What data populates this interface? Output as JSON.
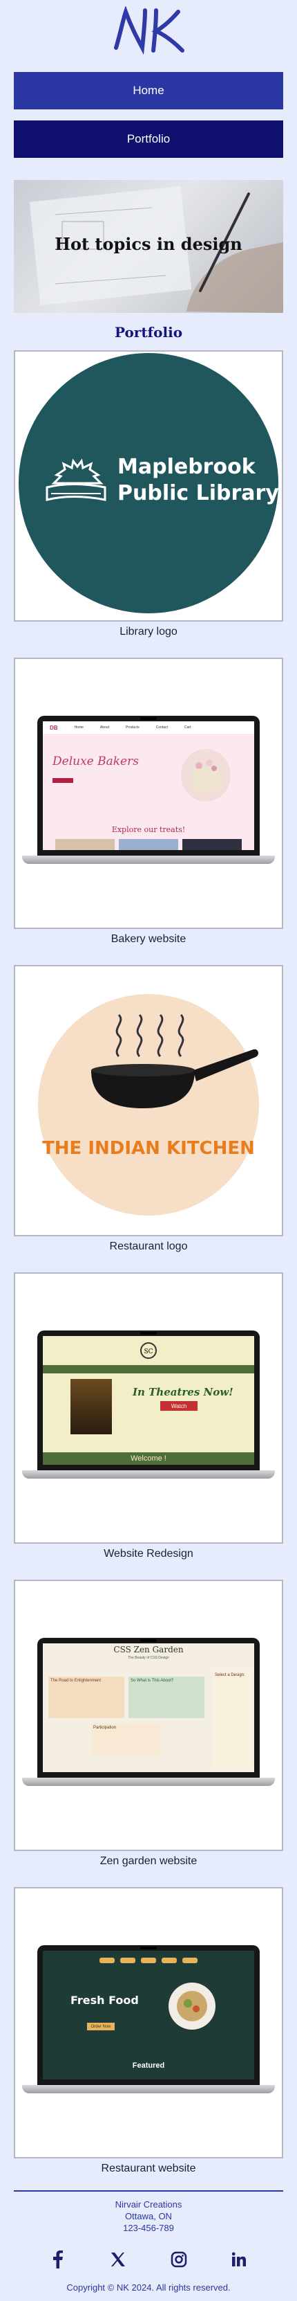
{
  "header": {
    "logo_text": "NK"
  },
  "nav": {
    "home_label": "Home",
    "portfolio_label": "Portfolio"
  },
  "hero": {
    "title": "Hot topics in design"
  },
  "portfolio": {
    "title": "Portfolio",
    "items": [
      {
        "caption": "Library logo",
        "line1": "Maplebrook",
        "line2": "Public Library"
      },
      {
        "caption": "Bakery website",
        "site_title": "Deluxe Bakers",
        "tagline": "Explore our treats!",
        "nav": [
          "Home",
          "About",
          "Products",
          "Contact",
          "Cart"
        ]
      },
      {
        "caption": "Restaurant logo",
        "brand": "THE INDIAN KITCHEN"
      },
      {
        "caption": "Website Redesign",
        "headline": "In Theatres Now!",
        "cta": "Watch",
        "welcome": "Welcome !"
      },
      {
        "caption": "Zen garden website",
        "site_title": "CSS Zen Garden",
        "subtitle": "The Beauty of CSS Design",
        "col_a": "The Road to Enlightenment",
        "col_b": "So What is This About?",
        "col_c": "Participation",
        "side": "Select a Design:"
      },
      {
        "caption": "Restaurant website",
        "headline": "Fresh Food",
        "cta": "Order Now",
        "featured": "Featured"
      }
    ]
  },
  "footer": {
    "name": "Nirvair Creations",
    "location": "Ottawa, ON",
    "phone": "123-456-789",
    "copyright": "Copyright © NK 2024. All rights reserved.",
    "socials": [
      "facebook-icon",
      "x-icon",
      "instagram-icon",
      "linkedin-icon"
    ]
  },
  "colors": {
    "primary": "#2a36a2",
    "navy": "#0f0f6e",
    "background": "#e6ecfb",
    "library_teal": "#1f575c",
    "kitchen_orange": "#e87d1e",
    "kitchen_green": "#3d9a3a"
  }
}
